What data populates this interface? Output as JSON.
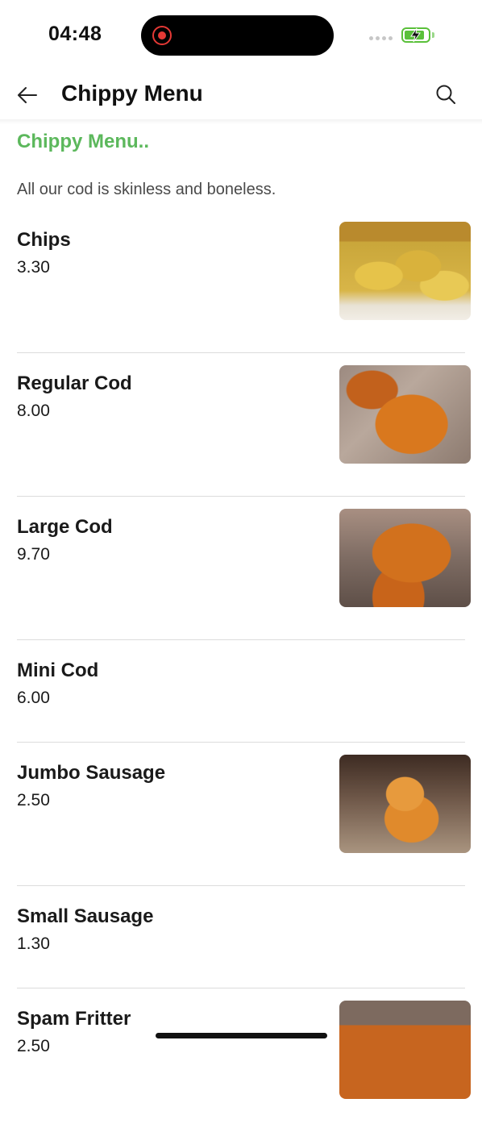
{
  "status_bar": {
    "time": "04:48",
    "battery_level": 0.85,
    "battery_color": "#5ac03a",
    "recording_color": "#e53935"
  },
  "header": {
    "title": "Chippy Menu",
    "back_icon": "arrow-left-icon",
    "search_icon": "search-icon"
  },
  "section": {
    "title": "Chippy Menu..",
    "title_color": "#5cb85c",
    "description": "All our cod is skinless and boneless."
  },
  "menu": {
    "items": [
      {
        "name": "Chips",
        "price": "3.30",
        "has_image": true,
        "image": "chips-photo"
      },
      {
        "name": "Regular Cod",
        "price": "8.00",
        "has_image": true,
        "image": "battered-cod-photo"
      },
      {
        "name": "Large Cod",
        "price": "9.70",
        "has_image": true,
        "image": "battered-cod-photo"
      },
      {
        "name": "Mini Cod",
        "price": "6.00",
        "has_image": false
      },
      {
        "name": "Jumbo Sausage",
        "price": "2.50",
        "has_image": true,
        "image": "battered-sausage-photo"
      },
      {
        "name": "Small Sausage",
        "price": "1.30",
        "has_image": false
      },
      {
        "name": "Spam Fritter",
        "price": "2.50",
        "has_image": true,
        "image": "spam-fritter-photo"
      }
    ]
  }
}
